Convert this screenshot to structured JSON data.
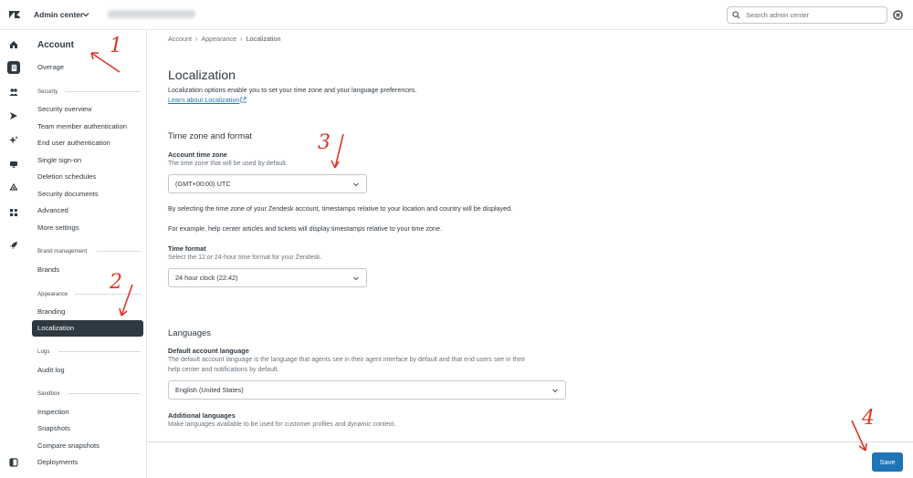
{
  "header": {
    "app_name": "Admin center",
    "search_placeholder": "Search admin center"
  },
  "sidebar": {
    "title": "Account",
    "overage": "Overage",
    "sections": {
      "security": "Security",
      "brand_management": "Brand management",
      "appearance": "Appearance",
      "logs": "Logs",
      "sandbox": "Sandbox"
    },
    "security_items": [
      "Security overview",
      "Team member authentication",
      "End user authentication",
      "Single sign-on",
      "Deletion schedules",
      "Security documents",
      "Advanced",
      "More settings"
    ],
    "brands": "Brands",
    "branding": "Branding",
    "localization": "Localization",
    "audit_log": "Audit log",
    "sandbox_items": [
      "Inspection",
      "Snapshots",
      "Compare snapshots",
      "Deployments"
    ]
  },
  "breadcrumb": [
    "Account",
    "Appearance",
    "Localization"
  ],
  "page": {
    "title": "Localization",
    "description": "Localization options enable you to set your time zone and your language preferences.",
    "learn_link": "Learn about Localization"
  },
  "time_zone_section": {
    "title": "Time zone and format",
    "account_tz_label": "Account time zone",
    "account_tz_hint": "The time zone that will be used by default.",
    "account_tz_value": "(GMT+00:00) UTC",
    "para1": "By selecting the time zone of your Zendesk account, timestamps relative to your location and country will be displayed.",
    "para2": "For example, help center articles and tickets will display timestamps relative to your time zone.",
    "time_format_label": "Time format",
    "time_format_hint": "Select the 12 or 24-hour time format for your Zendesk.",
    "time_format_value": "24 hour clock (22:42)"
  },
  "languages_section": {
    "title": "Languages",
    "default_label": "Default account language",
    "default_hint_1": "The default account language is the language that agents see in their agent interface by default and that end users see in their",
    "default_hint_2": "help center and notifications by default.",
    "default_value": "English (United States)",
    "additional_label": "Additional languages",
    "additional_hint": "Make languages available to be used for customer profiles and dynamic content."
  },
  "save_label": "Save",
  "annotations": [
    "1",
    "2",
    "3",
    "4"
  ],
  "colors": {
    "accent": "#1f73b7",
    "dark": "#2f3941",
    "annotation": "#e0352b"
  }
}
